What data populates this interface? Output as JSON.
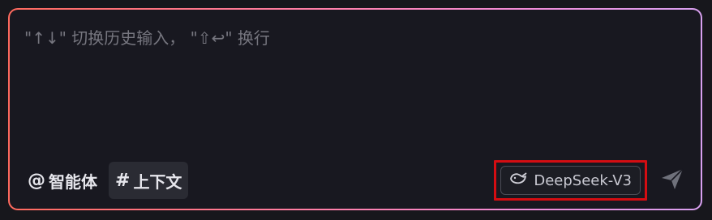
{
  "input": {
    "placeholder": "\"↑↓\" 切换历史输入， \"⇧↩\" 换行",
    "value": ""
  },
  "toolbar": {
    "agent": {
      "symbol": "@",
      "label": "智能体"
    },
    "context": {
      "symbol": "#",
      "label": "上下文"
    }
  },
  "model": {
    "name": "DeepSeek-V3",
    "icon": "deepseek-whale-icon"
  },
  "send": {
    "icon": "send-icon"
  },
  "colors": {
    "background": "#17171c",
    "border_gradient": [
      "#ff6a5e",
      "#ff7fa8",
      "#d8a0f0"
    ],
    "highlight": "#d40d12"
  }
}
